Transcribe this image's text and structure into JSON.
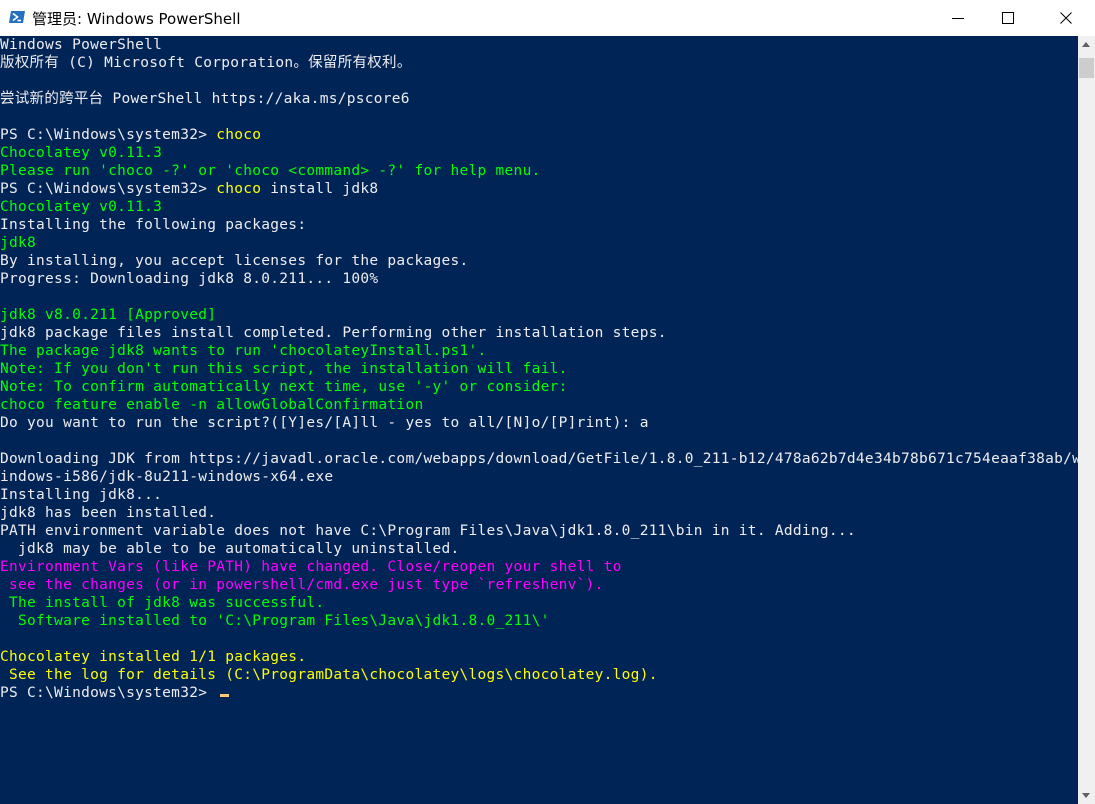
{
  "window": {
    "title": "管理员: Windows PowerShell",
    "icon": "powershell-icon",
    "controls": {
      "minimize": "minimize-icon",
      "maximize": "maximize-icon",
      "close": "close-icon"
    }
  },
  "colors": {
    "console_background": "#012456",
    "default_text": "#eeedf0",
    "command_highlight": "#ffff00",
    "info_text": "#00ff00",
    "warning_text": "#ff00ff",
    "cursor": "#feca79"
  },
  "console": {
    "lines": [
      "Windows PowerShell",
      "版权所有 (C) Microsoft Corporation。保留所有权利。",
      "",
      "尝试新的跨平台 PowerShell https://aka.ms/pscore6",
      "",
      "PS C:\\Windows\\system32> ",
      "Chocolatey v0.11.3",
      "Please run 'choco -?' or 'choco <command> -?' for help menu.",
      "PS C:\\Windows\\system32> ",
      "Chocolatey v0.11.3",
      "Installing the following packages:",
      "jdk8",
      "By installing, you accept licenses for the packages.",
      "Progress: Downloading jdk8 8.0.211... 100%",
      "",
      "jdk8 v8.0.211 [Approved]",
      "jdk8 package files install completed. Performing other installation steps.",
      "The package jdk8 wants to run 'chocolateyInstall.ps1'.",
      "Note: If you don't run this script, the installation will fail.",
      "Note: To confirm automatically next time, use '-y' or consider:",
      "choco feature enable -n allowGlobalConfirmation",
      "Do you want to run the script?([Y]es/[A]ll - yes to all/[N]o/[P]rint): a",
      "",
      "Downloading JDK from https://javadl.oracle.com/webapps/download/GetFile/1.8.0_211-b12/478a62b7d4e34b78b671c754eaaf38ab/w",
      "indows-i586/jdk-8u211-windows-x64.exe",
      "Installing jdk8...",
      "jdk8 has been installed.",
      "PATH environment variable does not have C:\\Program Files\\Java\\jdk1.8.0_211\\bin in it. Adding...",
      "  jdk8 may be able to be automatically uninstalled.",
      "Environment Vars (like PATH) have changed. Close/reopen your shell to",
      " see the changes (or in powershell/cmd.exe just type `refreshenv`).",
      " The install of jdk8 was successful.",
      "  Software installed to 'C:\\Program Files\\Java\\jdk1.8.0_211\\'",
      "",
      "Chocolatey installed 1/1 packages.",
      " See the log for details (C:\\ProgramData\\chocolatey\\logs\\chocolatey.log).",
      "PS C:\\Windows\\system32> "
    ],
    "commands": {
      "cmd1": "choco",
      "cmd2_name": "choco",
      "cmd2_args": " install jdk8"
    }
  },
  "scrollbar": {
    "up_icon": "scroll-up-arrow-icon",
    "down_icon": "scroll-down-arrow-icon"
  }
}
